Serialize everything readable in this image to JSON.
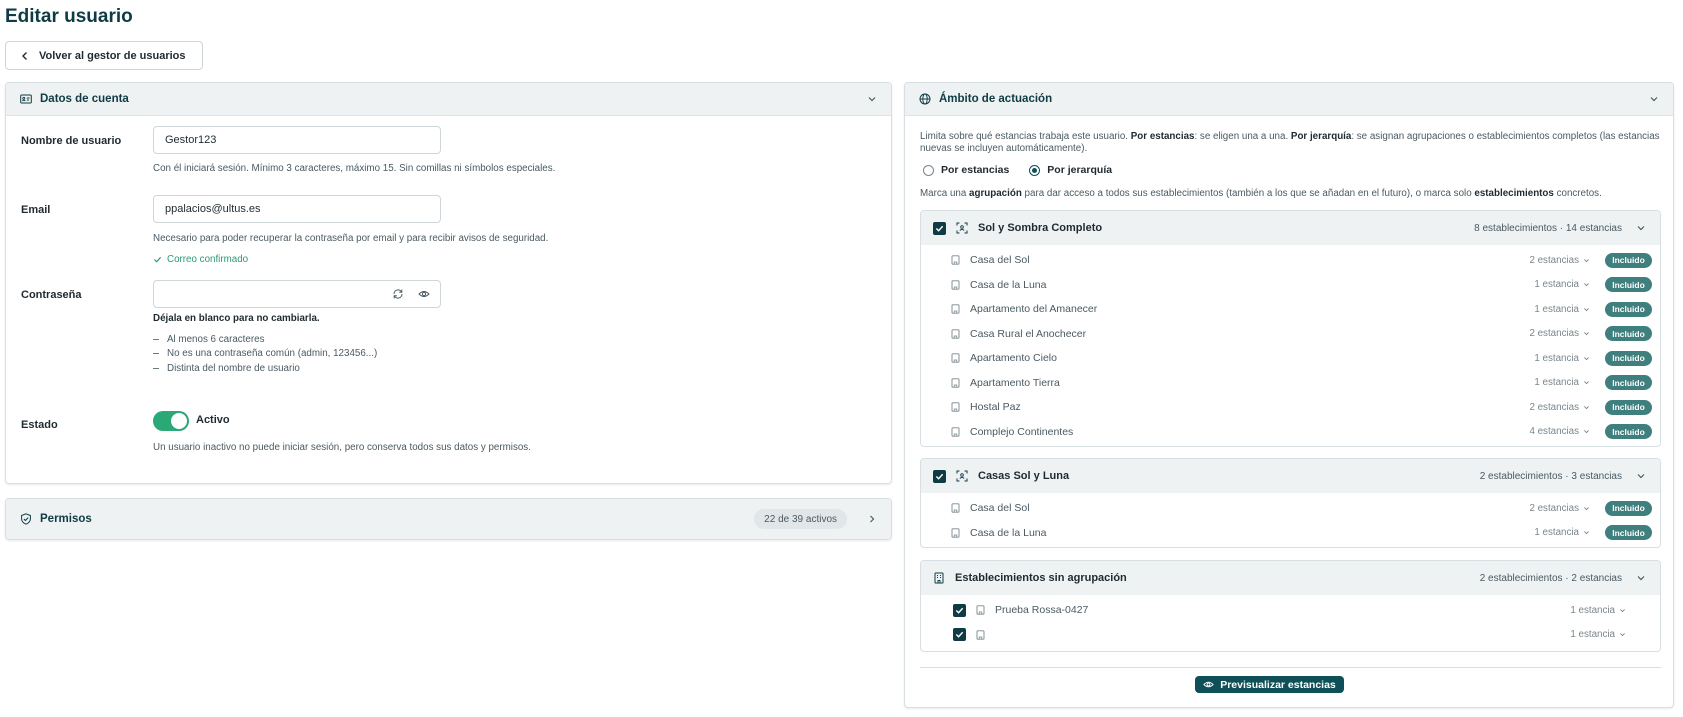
{
  "page": {
    "title": "Editar usuario",
    "back_label": "Volver al gestor de usuarios"
  },
  "account": {
    "title": "Datos de cuenta",
    "username": {
      "label": "Nombre de usuario",
      "value": "Gestor123",
      "help": "Con él iniciará sesión. Mínimo 3 caracteres, máximo 15. Sin comillas ni símbolos especiales."
    },
    "email": {
      "label": "Email",
      "value": "ppalacios@ultus.es",
      "help": "Necesario para poder recuperar la contraseña por email y para recibir avisos de seguridad.",
      "confirmed": "Correo confirmado"
    },
    "password": {
      "label": "Contraseña",
      "value": "",
      "note": "Déjala en blanco para no cambiarla.",
      "rules": [
        "Al menos 6 caracteres",
        "No es una contraseña común (admin, 123456...)",
        "Distinta del nombre de usuario"
      ]
    },
    "status": {
      "label": "Estado",
      "value": "Activo",
      "help": "Un usuario inactivo no puede iniciar sesión, pero conserva todos sus datos y permisos."
    }
  },
  "permissions": {
    "title": "Permisos",
    "count": "22 de 39 activos"
  },
  "scope": {
    "title": "Ámbito de actuación",
    "desc_1": "Limita sobre qué estancias trabaja este usuario. ",
    "desc_b1": "Por estancias",
    "desc_2": ": se eligen una a una. ",
    "desc_b2": "Por jerarquía",
    "desc_3": ": se asignan agrupaciones o establecimientos completos (las estancias nuevas se incluyen automáticamente).",
    "radio_1": "Por estancias",
    "radio_2": "Por jerarquía",
    "hint_1": "Marca una ",
    "hint_b1": "agrupación",
    "hint_2": " para dar acceso a todos sus establecimientos (también a los que se añadan en el futuro), o marca solo ",
    "hint_b2": "establecimientos",
    "hint_3": " concretos.",
    "groups": [
      {
        "name": "Sol y Sombra Completo",
        "meta": "8 establecimientos · 14 estancias",
        "rows": [
          {
            "name": "Casa del Sol",
            "stays": "2 estancias",
            "badge": "Incluido"
          },
          {
            "name": "Casa de la Luna",
            "stays": "1 estancia",
            "badge": "Incluido"
          },
          {
            "name": "Apartamento del Amanecer",
            "stays": "1 estancia",
            "badge": "Incluido"
          },
          {
            "name": "Casa Rural el Anochecer",
            "stays": "2 estancias",
            "badge": "Incluido"
          },
          {
            "name": "Apartamento Cielo",
            "stays": "1 estancia",
            "badge": "Incluido"
          },
          {
            "name": "Apartamento Tierra",
            "stays": "1 estancia",
            "badge": "Incluido"
          },
          {
            "name": "Hostal Paz",
            "stays": "2 estancias",
            "badge": "Incluido"
          },
          {
            "name": "Complejo Continentes",
            "stays": "4 estancias",
            "badge": "Incluido"
          }
        ]
      },
      {
        "name": "Casas Sol y Luna",
        "meta": "2 establecimientos · 3 estancias",
        "rows": [
          {
            "name": "Casa del Sol",
            "stays": "2 estancias",
            "badge": "Incluido"
          },
          {
            "name": "Casa de la Luna",
            "stays": "1 estancia",
            "badge": "Incluido"
          }
        ]
      }
    ],
    "ungrouped": {
      "name": "Establecimientos sin agrupación",
      "meta": "2 establecimientos · 2 estancias",
      "rows": [
        {
          "name": "Prueba Rossa-0427",
          "stays": "1 estancia"
        },
        {
          "name": "",
          "stays": "1 estancia"
        }
      ]
    },
    "preview_label": "Previsualizar estancias"
  },
  "colors": {
    "brand": "#0f3b44",
    "active": "#2aa876",
    "badge": "#3f7f7e"
  }
}
